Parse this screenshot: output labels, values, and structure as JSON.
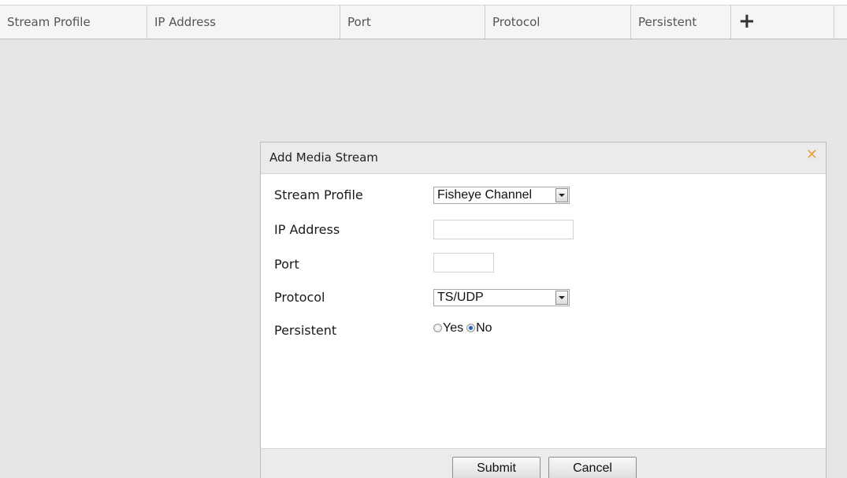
{
  "table": {
    "columns": [
      "Stream Profile",
      "IP Address",
      "Port",
      "Protocol",
      "Persistent"
    ],
    "add_icon": "plus-icon",
    "add_glyph": "+"
  },
  "dialog": {
    "title": "Add Media Stream",
    "close_icon": "close-icon",
    "close_glyph": "✕",
    "accent_color": "#e8a33c",
    "fields": {
      "stream_profile": {
        "label": "Stream Profile",
        "value": "Fisheye Channel"
      },
      "ip_address": {
        "label": "IP Address",
        "value": "",
        "placeholder": ""
      },
      "port": {
        "label": "Port",
        "value": "",
        "placeholder": ""
      },
      "protocol": {
        "label": "Protocol",
        "value": "TS/UDP"
      },
      "persistent": {
        "label": "Persistent",
        "options": [
          "Yes",
          "No"
        ],
        "selected": "No"
      }
    },
    "buttons": {
      "submit": "Submit",
      "cancel": "Cancel"
    }
  }
}
